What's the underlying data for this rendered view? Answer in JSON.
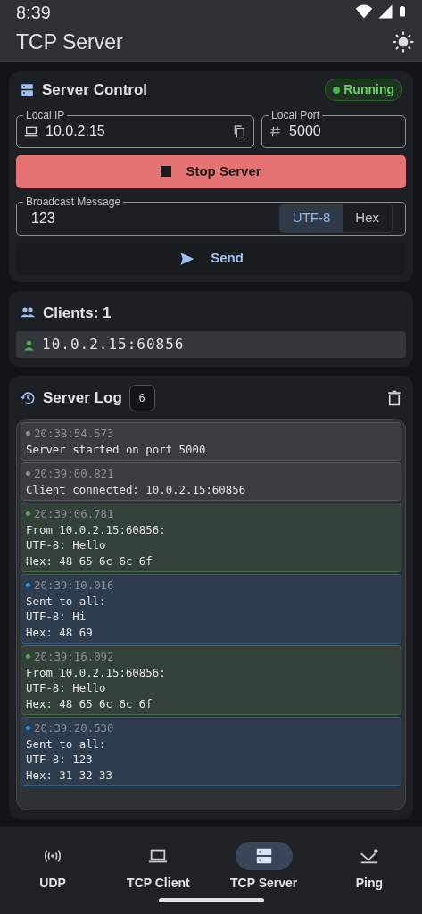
{
  "status_bar": {
    "time": "8:39"
  },
  "app_bar": {
    "title": "TCP Server"
  },
  "server_control": {
    "title": "Server Control",
    "status": "Running",
    "running": true,
    "local_ip": {
      "label": "Local IP",
      "value": "10.0.2.15"
    },
    "local_port": {
      "label": "Local Port",
      "value": "5000"
    },
    "stop_button": "Stop Server",
    "broadcast": {
      "label": "Broadcast Message",
      "value": "123"
    },
    "encodings": [
      {
        "label": "UTF-8",
        "selected": true
      },
      {
        "label": "Hex",
        "selected": false
      }
    ],
    "send_button": "Send"
  },
  "clients": {
    "title": "Clients: 1",
    "items": [
      "10.0.2.15:60856"
    ]
  },
  "server_log": {
    "title": "Server Log",
    "count": "6",
    "entries": [
      {
        "kind": "info",
        "time": "20:38:54.573",
        "lines": [
          "Server started on port 5000"
        ]
      },
      {
        "kind": "info",
        "time": "20:39:00.821",
        "lines": [
          "Client connected: 10.0.2.15:60856"
        ]
      },
      {
        "kind": "received",
        "time": "20:39:06.781",
        "lines": [
          "From 10.0.2.15:60856:",
          "UTF-8: Hello",
          "Hex: 48 65 6c 6c 6f"
        ]
      },
      {
        "kind": "sent",
        "time": "20:39:10.016",
        "lines": [
          "Sent to all:",
          "UTF-8: Hi",
          "Hex: 48 69"
        ]
      },
      {
        "kind": "received",
        "time": "20:39:16.092",
        "lines": [
          "From 10.0.2.15:60856:",
          "UTF-8: Hello",
          "Hex: 48 65 6c 6c 6f"
        ]
      },
      {
        "kind": "sent",
        "time": "20:39:20.530",
        "lines": [
          "Sent to all:",
          "UTF-8: 123",
          "Hex: 31 32 33"
        ]
      }
    ]
  },
  "bottom_nav": [
    {
      "label": "UDP",
      "selected": false
    },
    {
      "label": "TCP Client",
      "selected": false
    },
    {
      "label": "TCP Server",
      "selected": true
    },
    {
      "label": "Ping",
      "selected": false
    }
  ]
}
